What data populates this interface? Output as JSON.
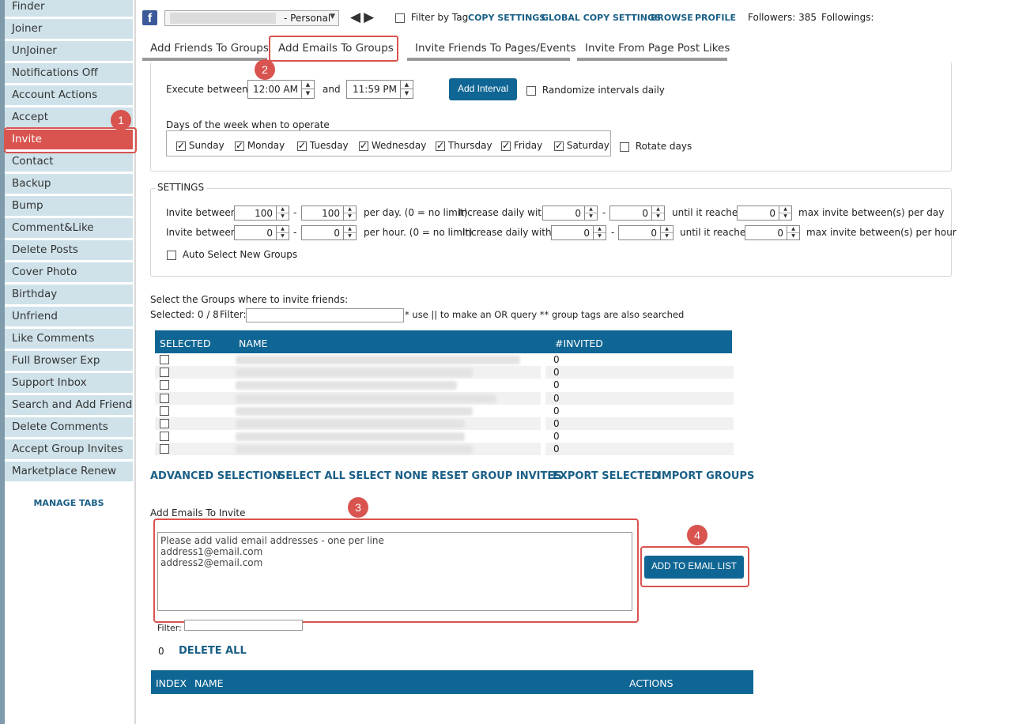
{
  "sidebar": {
    "items": [
      {
        "label": "Finder"
      },
      {
        "label": "Joiner"
      },
      {
        "label": "UnJoiner"
      },
      {
        "label": "Notifications Off"
      },
      {
        "label": "Account Actions"
      },
      {
        "label": "Accept"
      },
      {
        "label": "Invite",
        "active": true
      },
      {
        "label": "Contact"
      },
      {
        "label": "Backup"
      },
      {
        "label": "Bump"
      },
      {
        "label": "Comment&Like"
      },
      {
        "label": "Delete Posts"
      },
      {
        "label": "Cover Photo"
      },
      {
        "label": "Birthday"
      },
      {
        "label": "Unfriend"
      },
      {
        "label": "Like Comments"
      },
      {
        "label": "Full Browser Exp"
      },
      {
        "label": "Support Inbox"
      },
      {
        "label": "Search and Add Friends"
      },
      {
        "label": "Delete Comments"
      },
      {
        "label": "Accept Group Invites"
      },
      {
        "label": "Marketplace Renew"
      }
    ],
    "manage_tabs": "MANAGE TABS"
  },
  "topbar": {
    "fb_glyph": "f",
    "account_suffix": "- Personal",
    "arrows": "◀▶",
    "filter_by_tag": "Filter by Tag",
    "copy_settings": "COPY SETTINGS",
    "global_copy_settings": "GLOBAL COPY SETTINGS",
    "browse": "BROWSE",
    "profile": "PROFILE",
    "followers": "Followers: 385",
    "followings": "Followings:"
  },
  "tabs": [
    {
      "label": "Add Friends To Groups"
    },
    {
      "label": "Add Emails To Groups",
      "active": true
    },
    {
      "label": "Invite Friends To Pages/Events"
    },
    {
      "label": "Invite From Page Post Likes"
    }
  ],
  "markers": {
    "m1": "1",
    "m2": "2",
    "m3": "3",
    "m4": "4"
  },
  "schedule": {
    "execute_between": "Execute between",
    "start_time": "12:00 AM",
    "and": "and",
    "end_time": "11:59 PM",
    "add_interval": "Add Interval",
    "randomize": "Randomize intervals daily",
    "days_label": "Days of the week when to operate",
    "days": [
      {
        "label": "Sunday",
        "checked": true
      },
      {
        "label": "Monday",
        "checked": true
      },
      {
        "label": "Tuesday",
        "checked": true
      },
      {
        "label": "Wednesday",
        "checked": true
      },
      {
        "label": "Thursday",
        "checked": true
      },
      {
        "label": "Friday",
        "checked": true
      },
      {
        "label": "Saturday",
        "checked": true
      }
    ],
    "rotate_days": "Rotate days"
  },
  "settings": {
    "title": "SETTINGS",
    "row1": {
      "label": "Invite between",
      "min": "100",
      "dash": "-",
      "max": "100",
      "per": "per day. (0 = no limit)",
      "increase": "Increase daily with",
      "inc_min": "0",
      "inc_max": "0",
      "until": "until it reaches",
      "reach": "0",
      "suffix": "max invite between(s) per day"
    },
    "row2": {
      "label": "Invite between",
      "min": "0",
      "dash": "-",
      "max": "0",
      "per": "per hour. (0 = no limit)",
      "increase": "Increase daily with",
      "inc_min": "0",
      "inc_max": "0",
      "until": "until it reaches",
      "reach": "0",
      "suffix": "max invite between(s) per hour"
    },
    "auto_select": "Auto Select New Groups"
  },
  "groups": {
    "title": "Select the Groups where to invite friends:",
    "selected": "Selected:  0 / 8",
    "filter_label": "Filter:",
    "filter_value": "",
    "hint": "* use || to make an OR query ** group tags are also searched",
    "headers": {
      "selected": "SELECTED",
      "name": "NAME",
      "invited": "#INVITED"
    },
    "rows": [
      {
        "invited": "0"
      },
      {
        "invited": "0"
      },
      {
        "invited": "0"
      },
      {
        "invited": "0"
      },
      {
        "invited": "0"
      },
      {
        "invited": "0"
      },
      {
        "invited": "0"
      },
      {
        "invited": "0"
      }
    ],
    "actions": {
      "advanced": "ADVANCED SELECTION",
      "select_all": "SELECT ALL",
      "select_none": "SELECT NONE",
      "reset": "RESET GROUP INVITES",
      "export": "EXPORT SELECTED",
      "import": "IMPORT GROUPS"
    }
  },
  "emails": {
    "title": "Add Emails To Invite",
    "placeholder_line1": "Please add valid email addresses - one per line",
    "placeholder_line2": "address1@email.com",
    "placeholder_line3": "address2@email.com",
    "add_button": "ADD TO EMAIL LIST",
    "filter_label": "Filter:",
    "filter_value": "",
    "count": "0",
    "delete_all": "DELETE ALL",
    "headers": {
      "index": "INDEX",
      "name": "NAME",
      "actions": "ACTIONS"
    }
  }
}
